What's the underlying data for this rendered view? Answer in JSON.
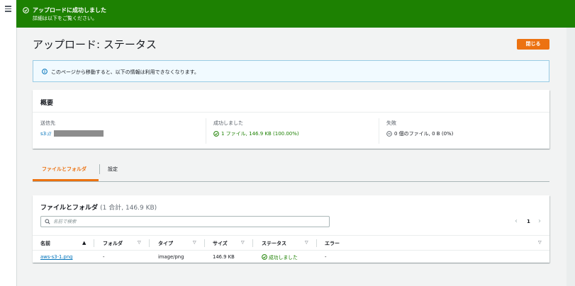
{
  "flash": {
    "title": "アップロードに成功しました",
    "subtitle": "詳細は以下をご覧ください。",
    "color": "#1d8102"
  },
  "page": {
    "title": "アップロード: ステータス",
    "close_label": "閉じる",
    "accent": "#ec7211"
  },
  "info": {
    "text": "このページから移動すると、以下の情報は利用できなくなります。"
  },
  "summary": {
    "heading": "概要",
    "destination_label": "送信先",
    "destination_value": "s3://",
    "succeeded_label": "成功しました",
    "succeeded_value": "1 ファイル, 146.9 KB (100.00%)",
    "failed_label": "失敗",
    "failed_value": "0 個のファイル, 0 B (0%)"
  },
  "tabs": [
    {
      "label": "ファイルとフォルダ",
      "active": true
    },
    {
      "label": "設定",
      "active": false
    }
  ],
  "files": {
    "title": "ファイルとフォルダ",
    "count": "(1 合計, 146.9 KB)",
    "search_placeholder": "名前で検索",
    "page_number": "1",
    "columns": [
      "名前",
      "フォルダ",
      "タイプ",
      "サイズ",
      "ステータス",
      "エラー"
    ],
    "rows": [
      {
        "name": "aws-s3-1.png",
        "folder": "-",
        "type": "image/png",
        "size": "146.9 KB",
        "status": "成功しました",
        "error": "-"
      }
    ]
  }
}
